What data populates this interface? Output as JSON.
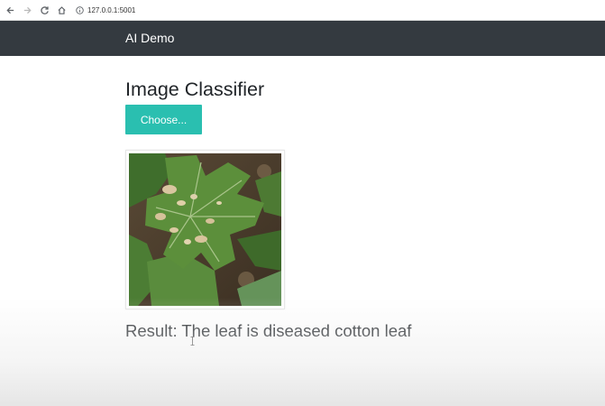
{
  "browser": {
    "url": "127.0.0.1:5001",
    "icons": [
      "back-arrow-icon",
      "forward-arrow-icon",
      "reload-icon",
      "home-icon",
      "info-icon"
    ]
  },
  "navbar": {
    "brand": "AI Demo",
    "background": "#343a40"
  },
  "main": {
    "title": "Image Classifier",
    "choose_button_label": "Choose...",
    "choose_button_color": "#2abfb0",
    "preview_watermark": "",
    "result_text": "Result:  The leaf is diseased cotton leaf"
  }
}
